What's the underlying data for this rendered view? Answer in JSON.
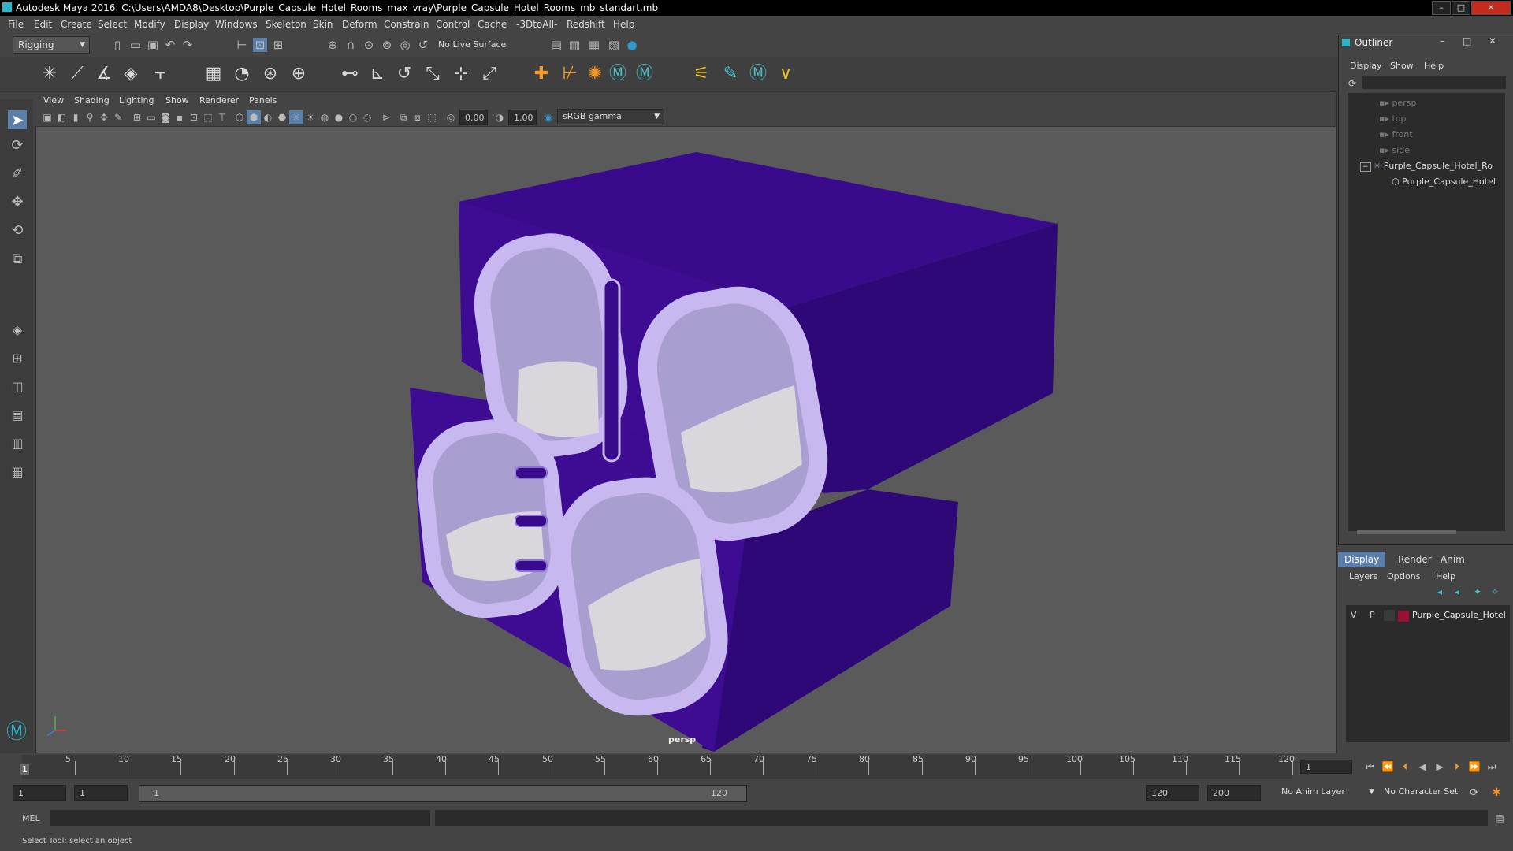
{
  "window": {
    "title": "Autodesk Maya 2016: C:\\Users\\AMDA8\\Desktop\\Purple_Capsule_Hotel_Rooms_max_vray\\Purple_Capsule_Hotel_Rooms_mb_standart.mb",
    "minimize": "–",
    "maximize": "□",
    "close": "✕"
  },
  "menubar": [
    "File",
    "Edit",
    "Create",
    "Select",
    "Modify",
    "Display",
    "Windows",
    "Skeleton",
    "Skin",
    "Deform",
    "Constrain",
    "Control",
    "Cache",
    "-3DtoAll-",
    "Redshift",
    "Help"
  ],
  "toolbar": {
    "mode": "Rigging",
    "live_surface": "No Live Surface"
  },
  "viewport": {
    "menus": [
      "View",
      "Shading",
      "Lighting",
      "Show",
      "Renderer",
      "Panels"
    ],
    "exposure": "0.00",
    "gamma": "1.00",
    "color_space": "sRGB gamma",
    "camera_label": "persp"
  },
  "outliner": {
    "title": "Outliner",
    "menus": [
      "Display",
      "Show",
      "Help"
    ],
    "items": [
      "persp",
      "top",
      "front",
      "side",
      "Purple_Capsule_Hotel_Ro",
      "Purple_Capsule_Hotel"
    ]
  },
  "layers": {
    "tabs": [
      "Display",
      "Render",
      "Anim"
    ],
    "menus": [
      "Layers",
      "Options",
      "Help"
    ],
    "row": {
      "v": "V",
      "p": "P",
      "name": "Purple_Capsule_Hotel",
      "color": "#9a1030"
    }
  },
  "timeline": {
    "ticks": [
      "5",
      "10",
      "15",
      "20",
      "25",
      "30",
      "35",
      "40",
      "45",
      "50",
      "55",
      "60",
      "65",
      "70",
      "75",
      "80",
      "85",
      "90",
      "95",
      "100",
      "105",
      "110",
      "115",
      "120"
    ],
    "start_label": "1",
    "current_frame": "1"
  },
  "range": {
    "start": "1",
    "playback_start": "1",
    "slider_start": "1",
    "slider_end": "120",
    "playback_end": "120",
    "end": "200",
    "anim_layer": "No Anim Layer",
    "character_set": "No Character Set"
  },
  "cmdline": {
    "label": "MEL"
  },
  "helpline": {
    "text": "Select Tool: select an object"
  },
  "colors": {
    "capsule": "#3a0a8c",
    "capsule_dark": "#2a0570",
    "frame": "#c8b8f0",
    "interior": "#a99ed0",
    "mattress": "#d9d7dc"
  }
}
